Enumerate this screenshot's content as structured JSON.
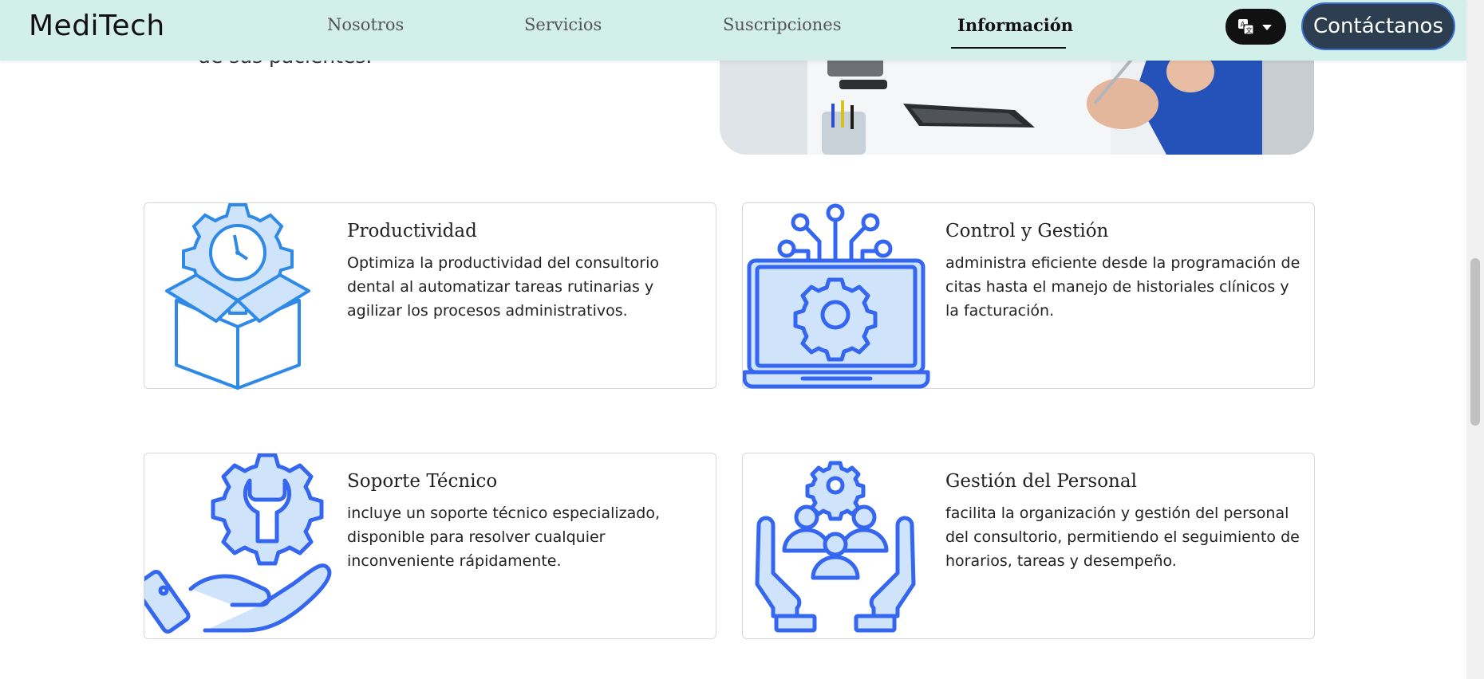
{
  "brand": "MediTech",
  "nav": {
    "links": [
      "Nosotros",
      "Servicios",
      "Suscripciones",
      "Información"
    ],
    "active": "Información",
    "lang_icon": "translate-icon",
    "contact_label": "Contáctanos"
  },
  "hero": {
    "text_fragment": "de sus pacientes."
  },
  "features": [
    {
      "title": "Productividad",
      "description": "Optimiza la productividad del consultorio dental al automatizar tareas rutinarias y agilizar los procesos administrativos.",
      "icon": "gear-clock-box-icon"
    },
    {
      "title": "Control y Gestión",
      "description": "administra eficiente desde la programación de citas hasta el manejo de historiales clínicos y la facturación.",
      "icon": "laptop-gear-icon"
    },
    {
      "title": "Soporte Técnico",
      "description": "incluye un soporte técnico especializado, disponible para resolver cualquier inconveniente rápidamente.",
      "icon": "hand-gear-wrench-icon"
    },
    {
      "title": "Gestión del Personal",
      "description": "facilita la organización y gestión del personal del consultorio, permitiendo el seguimiento de horarios, tareas y desempeño.",
      "icon": "team-hands-icon"
    }
  ],
  "colors": {
    "navbar_bg": "#d2efe9",
    "icon_blue": "#3566f0",
    "icon_fill": "#cfe3fb"
  }
}
